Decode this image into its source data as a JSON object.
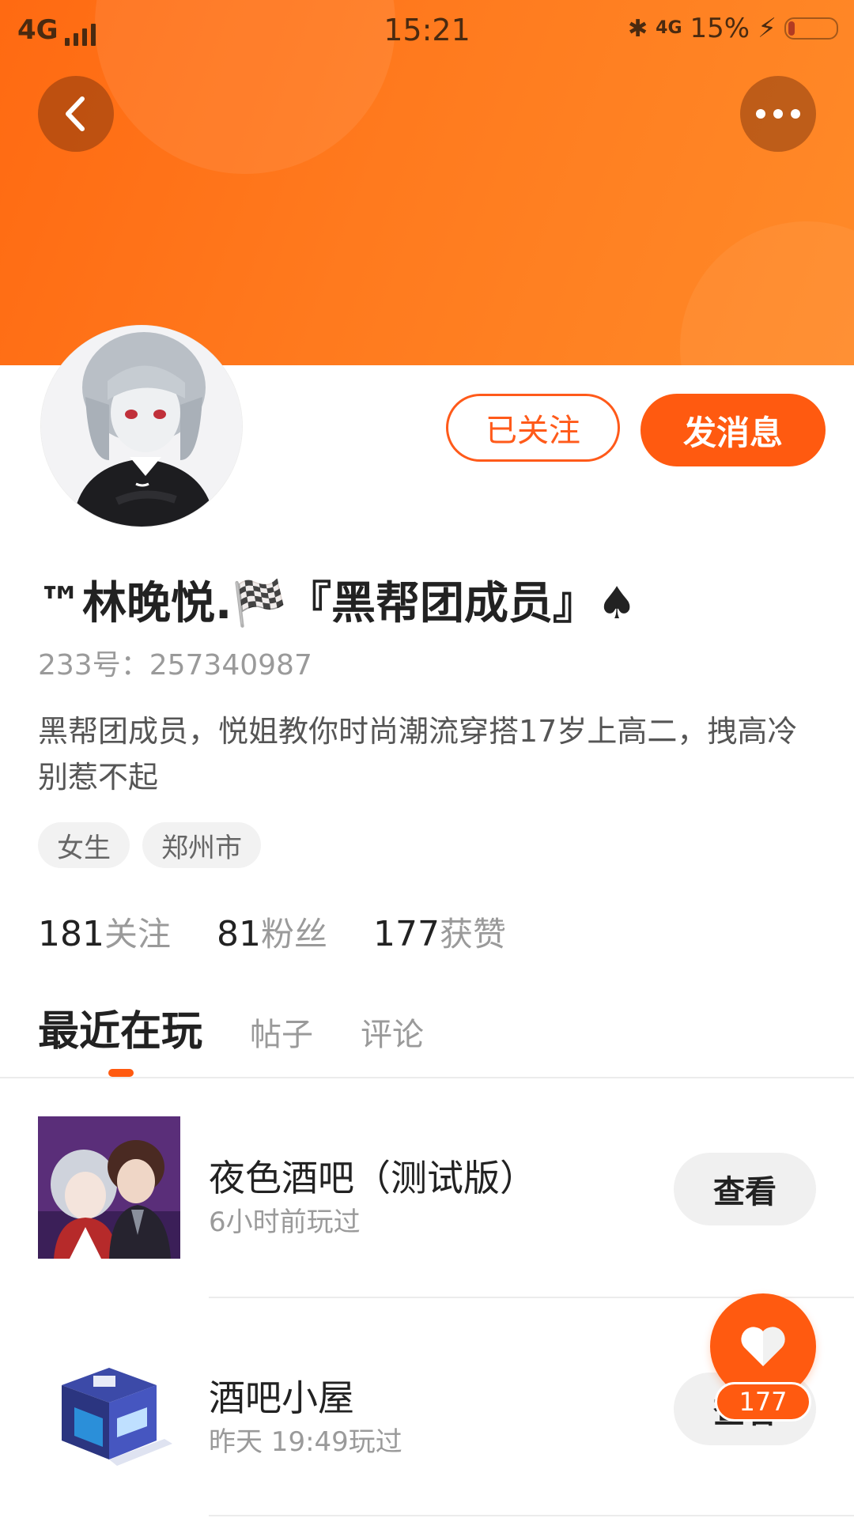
{
  "status_bar": {
    "network": "4G",
    "time": "15:21",
    "network2": "4G",
    "battery": "15%",
    "battery_level": 0.15
  },
  "header": {
    "back_icon": "chevron-left-icon",
    "more_icon": "more-dots-icon"
  },
  "profile": {
    "name": "™林晚悦.🏁『黑帮团成员』♠",
    "uid": "233号：257340987",
    "bio": "黑帮团成员，悦姐教你时尚潮流穿搭17岁上高二，拽高冷别惹不起",
    "tags": [
      "女生",
      "郑州市"
    ],
    "stats": [
      {
        "num": "181",
        "label": "关注"
      },
      {
        "num": "81",
        "label": "粉丝"
      },
      {
        "num": "177",
        "label": "获赞"
      }
    ]
  },
  "actions": {
    "follow_label": "已关注",
    "message_label": "发消息"
  },
  "tabs": [
    "最近在玩",
    "帖子",
    "评论"
  ],
  "games": [
    {
      "title": "夜色酒吧（测试版）",
      "subtitle": "6小时前玩过",
      "button": "查看"
    },
    {
      "title": "酒吧小屋",
      "subtitle": "昨天 19:49玩过",
      "button": "查看"
    }
  ],
  "like": {
    "count": "177",
    "icon": "heart-icon"
  },
  "colors": {
    "accent": "#ff5a10",
    "banner": "#ff7a1e"
  }
}
